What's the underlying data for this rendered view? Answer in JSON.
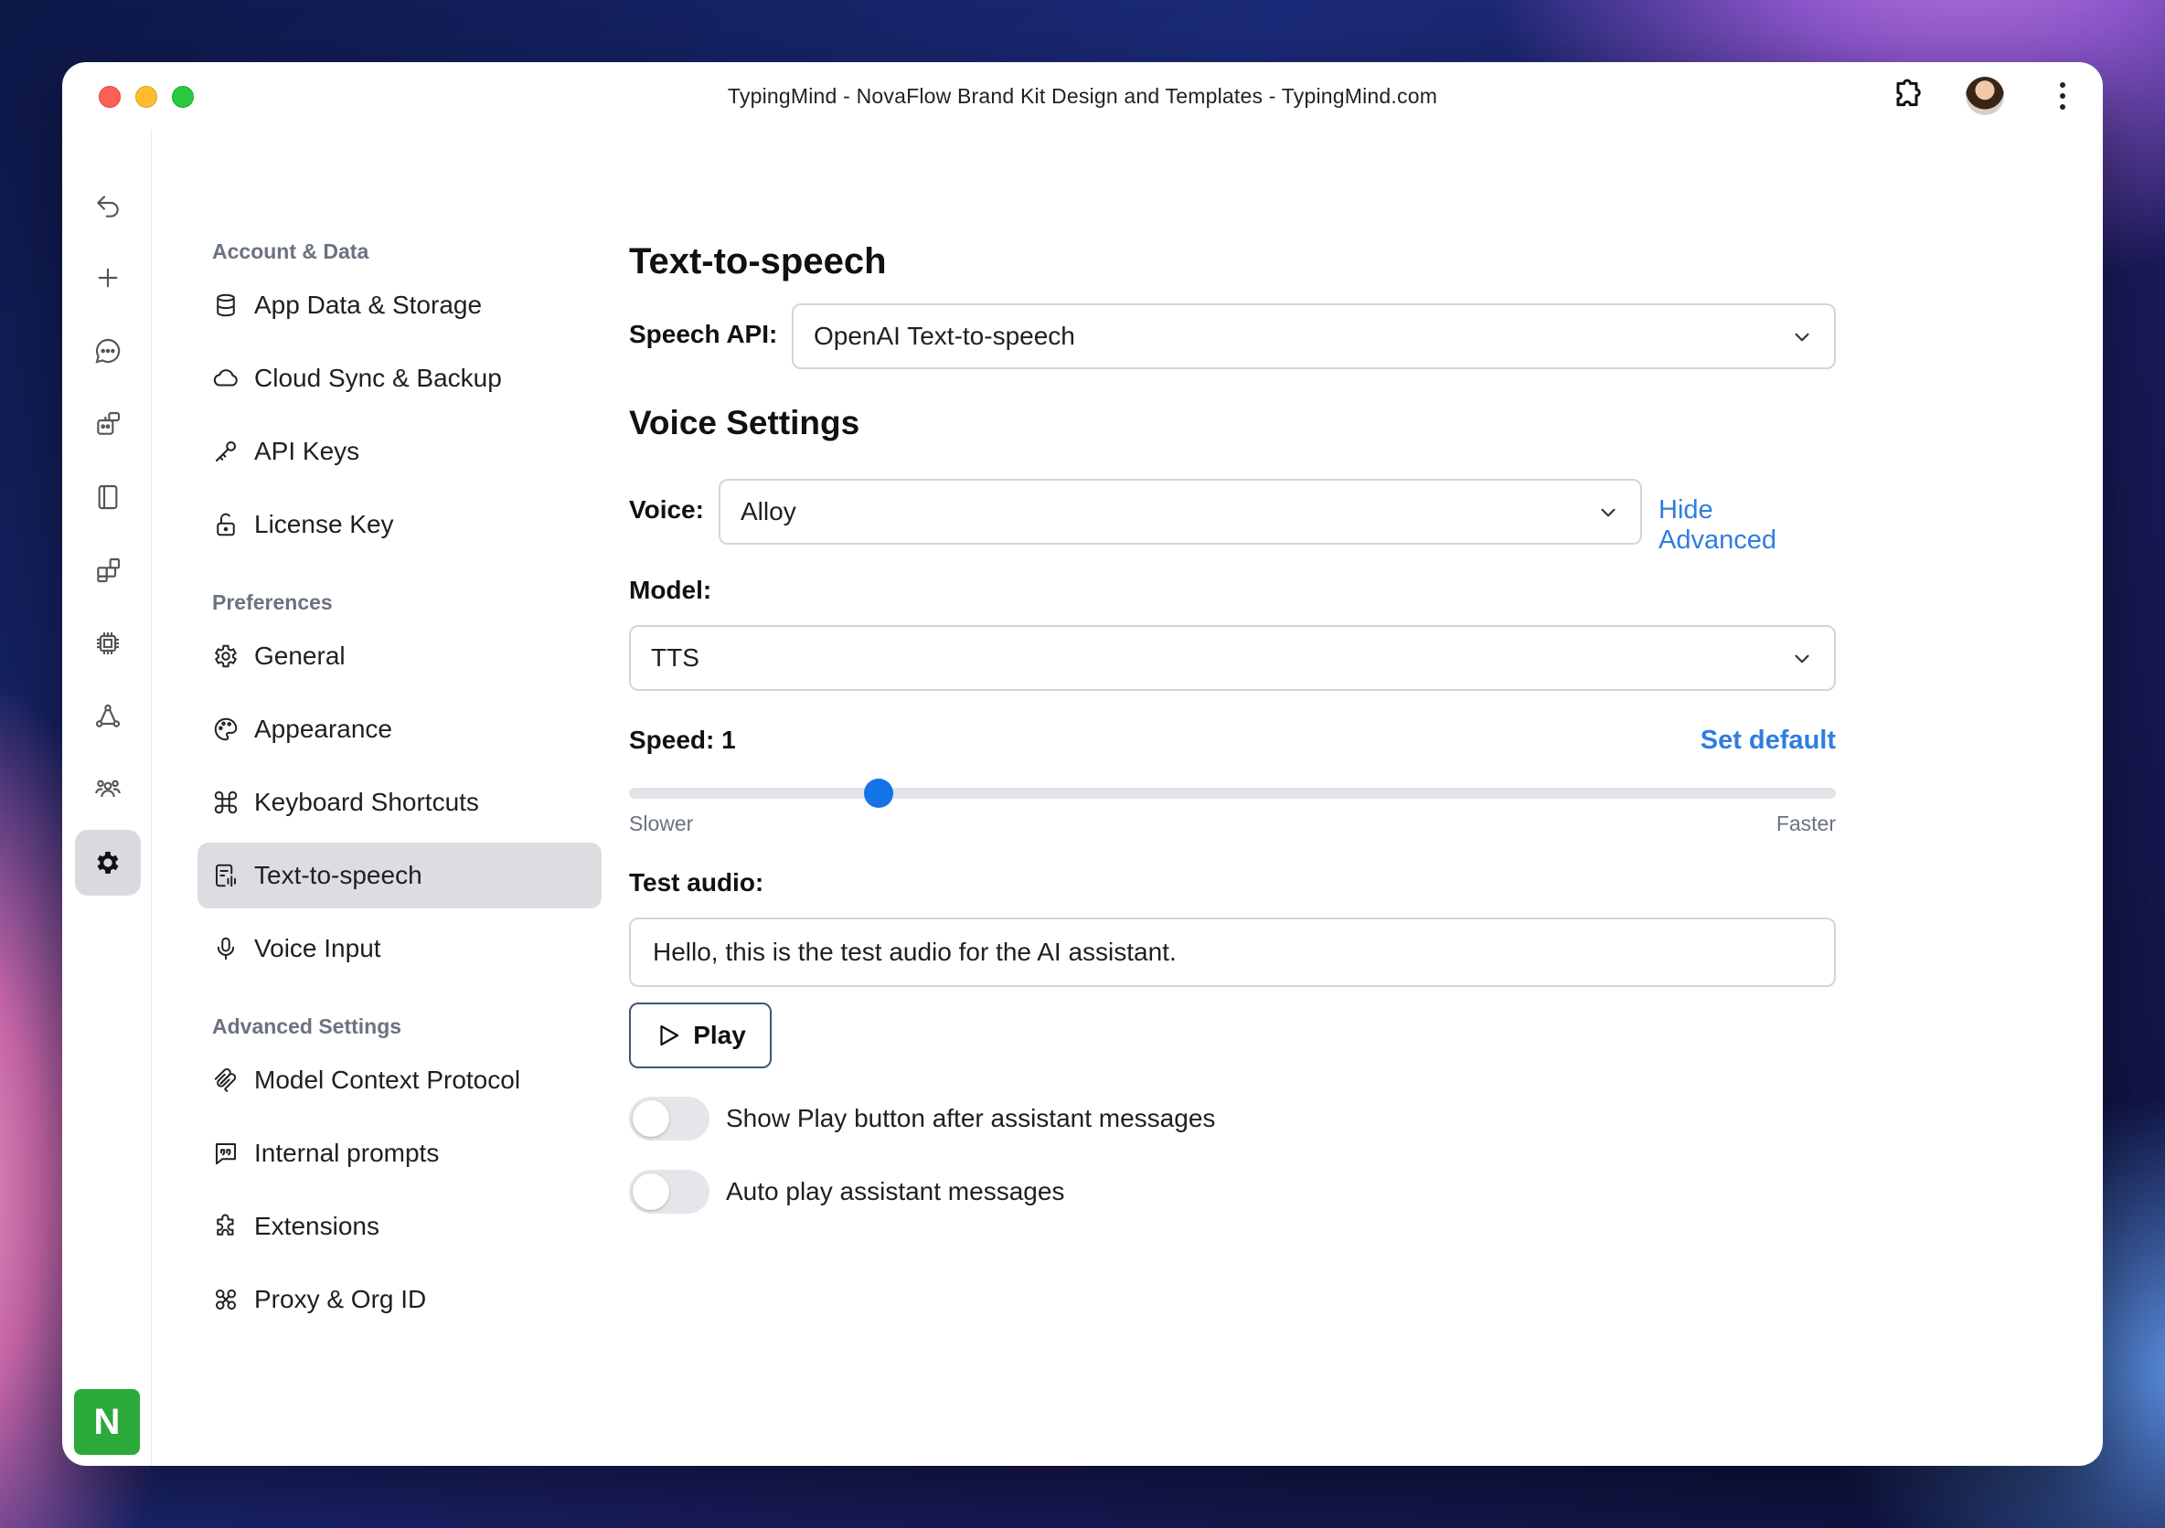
{
  "window": {
    "title": "TypingMind - NovaFlow Brand Kit Design and Templates - TypingMind.com"
  },
  "rail": {
    "items": [
      "back-icon",
      "new-chat-icon",
      "chat-icon",
      "agents-icon",
      "prompts-icon",
      "plugins-icon",
      "models-icon",
      "knowledge-icon",
      "teams-icon",
      "settings-icon"
    ],
    "active": "settings-icon",
    "workspace_initial": "N",
    "workspace_color": "#2ca93b"
  },
  "sidebar": {
    "sections": [
      {
        "title": "Account & Data",
        "items": [
          {
            "label": "App Data & Storage",
            "icon": "database-icon"
          },
          {
            "label": "Cloud Sync & Backup",
            "icon": "cloud-icon"
          },
          {
            "label": "API Keys",
            "icon": "key-icon"
          },
          {
            "label": "License Key",
            "icon": "lock-icon"
          }
        ]
      },
      {
        "title": "Preferences",
        "items": [
          {
            "label": "General",
            "icon": "gear-icon"
          },
          {
            "label": "Appearance",
            "icon": "palette-icon"
          },
          {
            "label": "Keyboard Shortcuts",
            "icon": "command-icon"
          },
          {
            "label": "Text-to-speech",
            "icon": "speech-icon"
          },
          {
            "label": "Voice Input",
            "icon": "microphone-icon"
          }
        ]
      },
      {
        "title": "Advanced Settings",
        "items": [
          {
            "label": "Model Context Protocol",
            "icon": "mcp-icon"
          },
          {
            "label": "Internal prompts",
            "icon": "quote-icon"
          },
          {
            "label": "Extensions",
            "icon": "puzzle-icon"
          },
          {
            "label": "Proxy & Org ID",
            "icon": "proxy-icon"
          }
        ]
      }
    ],
    "active_item": "Text-to-speech"
  },
  "main": {
    "title": "Text-to-speech",
    "speech_api_label": "Speech API:",
    "speech_api_value": "OpenAI Text-to-speech",
    "voice_settings_title": "Voice Settings",
    "voice_label": "Voice:",
    "voice_value": "Alloy",
    "hide_advanced": "Hide Advanced",
    "model_label": "Model:",
    "model_value": "TTS",
    "speed_label": "Speed: 1",
    "set_default": "Set default",
    "speed_fraction": 0.207,
    "slower": "Slower",
    "faster": "Faster",
    "test_audio_label": "Test audio:",
    "test_audio_value": "Hello, this is the test audio for the AI assistant.",
    "play_label": "Play",
    "toggles": [
      {
        "label": "Show Play button after assistant messages",
        "on": false
      },
      {
        "label": "Auto play assistant messages",
        "on": false
      }
    ]
  },
  "colors": {
    "accent": "#2f7de1",
    "slider": "#1473e6"
  }
}
